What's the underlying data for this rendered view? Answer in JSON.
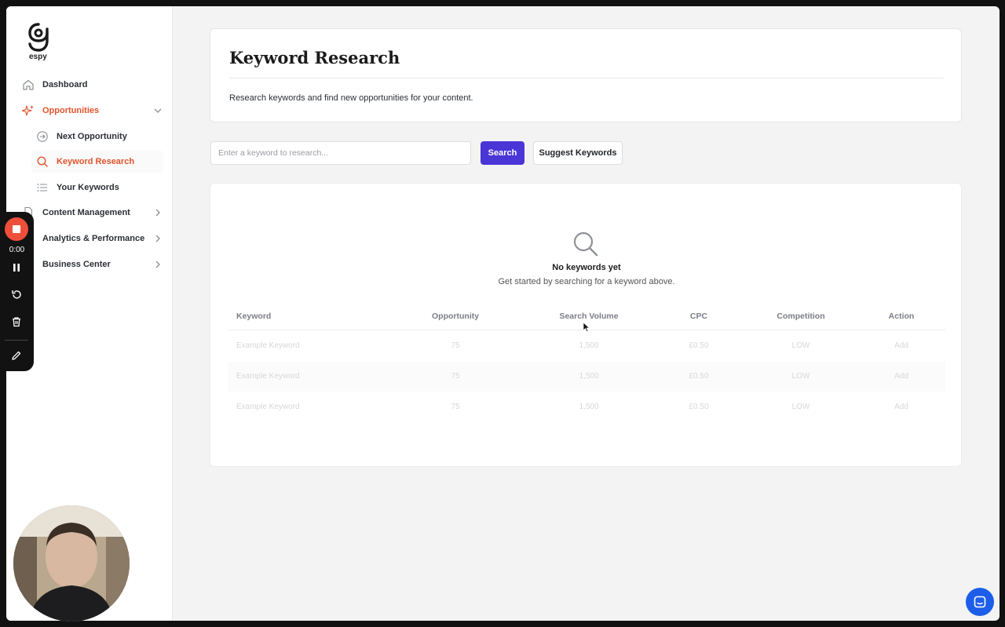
{
  "brand": {
    "name": "espy",
    "accent": "#e0532b"
  },
  "sidebar": {
    "items": [
      {
        "label": "Dashboard",
        "icon": "home-icon"
      },
      {
        "label": "Opportunities",
        "icon": "sparkles-icon",
        "expanded": true
      },
      {
        "label": "Next Opportunity",
        "icon": "arrow-circle-icon"
      },
      {
        "label": "Keyword Research",
        "icon": "search-icon",
        "selected": true
      },
      {
        "label": "Your Keywords",
        "icon": "list-icon"
      },
      {
        "label": "Content Management",
        "icon": "document-icon"
      },
      {
        "label": "Analytics & Performance",
        "icon": "chart-icon"
      },
      {
        "label": "Business Center",
        "icon": "briefcase-icon"
      }
    ]
  },
  "header": {
    "title": "Keyword Research",
    "subtitle": "Research keywords and find new opportunities for your content."
  },
  "search": {
    "placeholder": "Enter a keyword to research...",
    "value": "",
    "search_label": "Search",
    "suggest_label": "Suggest Keywords",
    "button_color": "#4a35d6"
  },
  "empty_state": {
    "title": "No keywords yet",
    "subtitle": "Get started by searching for a keyword above."
  },
  "table": {
    "columns": [
      "Keyword",
      "Opportunity",
      "Search Volume",
      "CPC",
      "Competition",
      "Action"
    ],
    "rows": [
      [
        "Example Keyword",
        "75",
        "1,500",
        "£0.50",
        "LOW",
        "Add"
      ],
      [
        "Example Keyword",
        "75",
        "1,500",
        "£0.50",
        "LOW",
        "Add"
      ],
      [
        "Example Keyword",
        "75",
        "1,500",
        "£0.50",
        "LOW",
        "Add"
      ]
    ]
  },
  "recorder": {
    "time": "0:00",
    "stop_color": "#ee4f3a"
  },
  "chat": {
    "color": "#1d5ee8"
  }
}
